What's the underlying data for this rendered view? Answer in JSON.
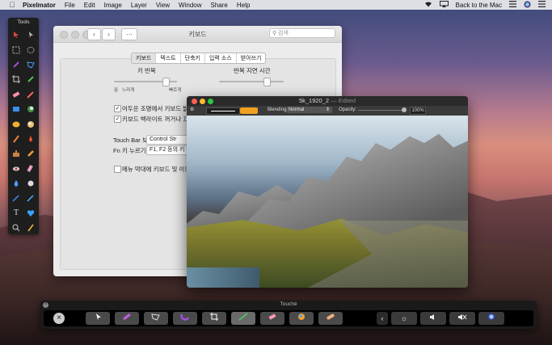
{
  "menubar": {
    "apple_icon": "apple-icon",
    "app_name": "Pixelmator",
    "items": [
      "File",
      "Edit",
      "Image",
      "Layer",
      "View",
      "Window",
      "Share",
      "Help"
    ],
    "status": {
      "wifi_icon": "wifi-icon",
      "airplay_icon": "airplay-icon",
      "back_to_mac": "Back to the Mac",
      "menu_icon": "list-icon",
      "siri_icon": "siri-icon",
      "notifications_icon": "notifications-icon"
    }
  },
  "tools_panel": {
    "title": "Tools"
  },
  "prefs_window": {
    "title": "키보드",
    "search_placeholder": "검색",
    "tabs": [
      "키보드",
      "텍스트",
      "단축키",
      "입력 소스",
      "받아쓰기"
    ],
    "active_tab": 0,
    "key_repeat": {
      "label": "키 반복",
      "min_label": "끔",
      "slow_label": "느리게",
      "fast_label": "빠르게"
    },
    "delay_until_repeat": {
      "label": "반복 지연 시간"
    },
    "checkbox_1": "어두운 조명에서 키보드 밝기 조",
    "checkbox_2": "키보드 백라이트 꺼거나 끄기:",
    "touchbar_label": "Touch Bar 보기",
    "touchbar_value": "Control Str",
    "fn_label": "Fn 키 누르기",
    "fn_value": "F1, F2 등의 키 5",
    "menu_bar_checkbox": "메뉴 막대에 키보드 및 이모티"
  },
  "image_window": {
    "title": "5k_1920_2",
    "edited": "— Edited",
    "blending_label": "Blending:",
    "blending_value": "Normal",
    "opacity_label": "Opacity:",
    "opacity_value": "100%",
    "colors": {
      "swatch": "#f0a020"
    }
  },
  "touche": {
    "title": "Touché",
    "tool_buttons": [
      "arrow-tool",
      "brush-tool",
      "lasso-tool",
      "magnet-tool",
      "crop-tool",
      "pen-tool",
      "eraser-tool",
      "color-picker-tool",
      "bandage-tool"
    ],
    "controls": [
      "collapse",
      "brightness",
      "volume",
      "mute",
      "siri"
    ]
  }
}
